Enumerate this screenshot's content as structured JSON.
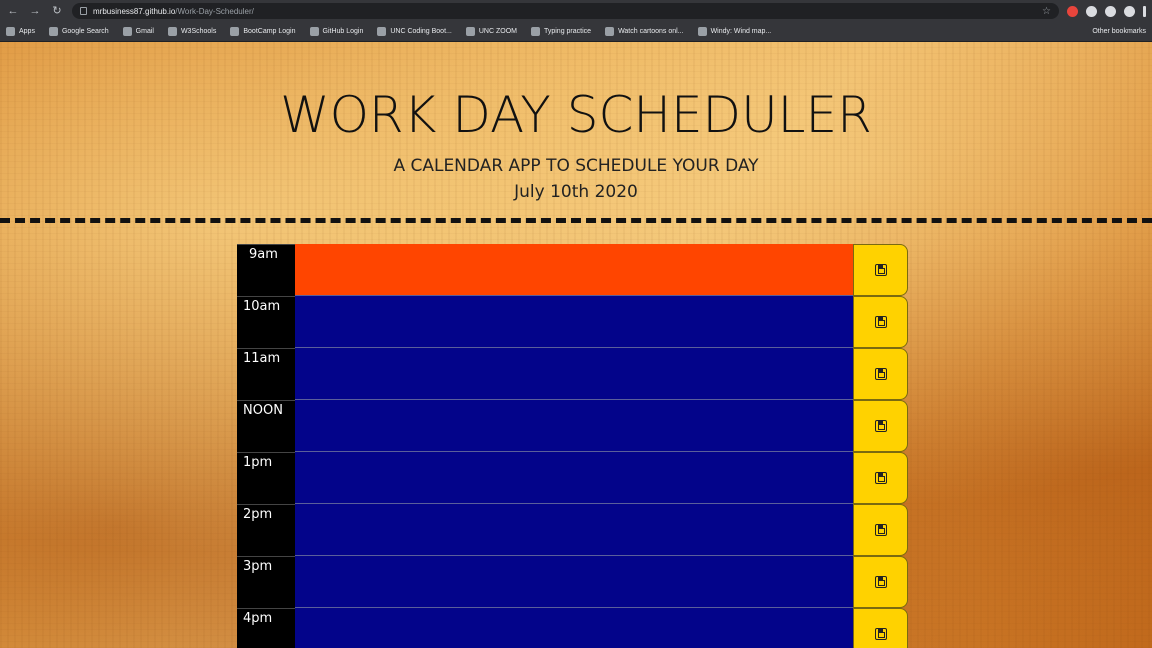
{
  "browser": {
    "url_host": "mrbusiness87.github.io",
    "url_path": "/Work-Day-Scheduler/",
    "bookmarks": [
      "Apps",
      "Google Search",
      "Gmail",
      "W3Schools",
      "BootCamp Login",
      "GitHub Login",
      "UNC Coding Boot...",
      "UNC ZOOM",
      "Typing practice",
      "Watch cartoons onl...",
      "Windy: Wind map..."
    ],
    "other_bookmarks": "Other bookmarks"
  },
  "header": {
    "title": "WORK DAY SCHEDULER",
    "subtitle": "A CALENDAR APP TO SCHEDULE YOUR DAY",
    "date": "July 10th 2020"
  },
  "schedule": {
    "rows": [
      {
        "hour": "9am",
        "state": "present",
        "color": "#ff4500"
      },
      {
        "hour": "10am",
        "state": "future",
        "color": "#03048a"
      },
      {
        "hour": "11am",
        "state": "future",
        "color": "#03048a"
      },
      {
        "hour": "NOON",
        "state": "future",
        "color": "#03048a"
      },
      {
        "hour": "1pm",
        "state": "future",
        "color": "#03048a"
      },
      {
        "hour": "2pm",
        "state": "future",
        "color": "#03048a"
      },
      {
        "hour": "3pm",
        "state": "future",
        "color": "#03048a"
      },
      {
        "hour": "4pm",
        "state": "future",
        "color": "#03048a"
      }
    ],
    "save_icon": "save-icon",
    "save_color": "#ffd200"
  }
}
